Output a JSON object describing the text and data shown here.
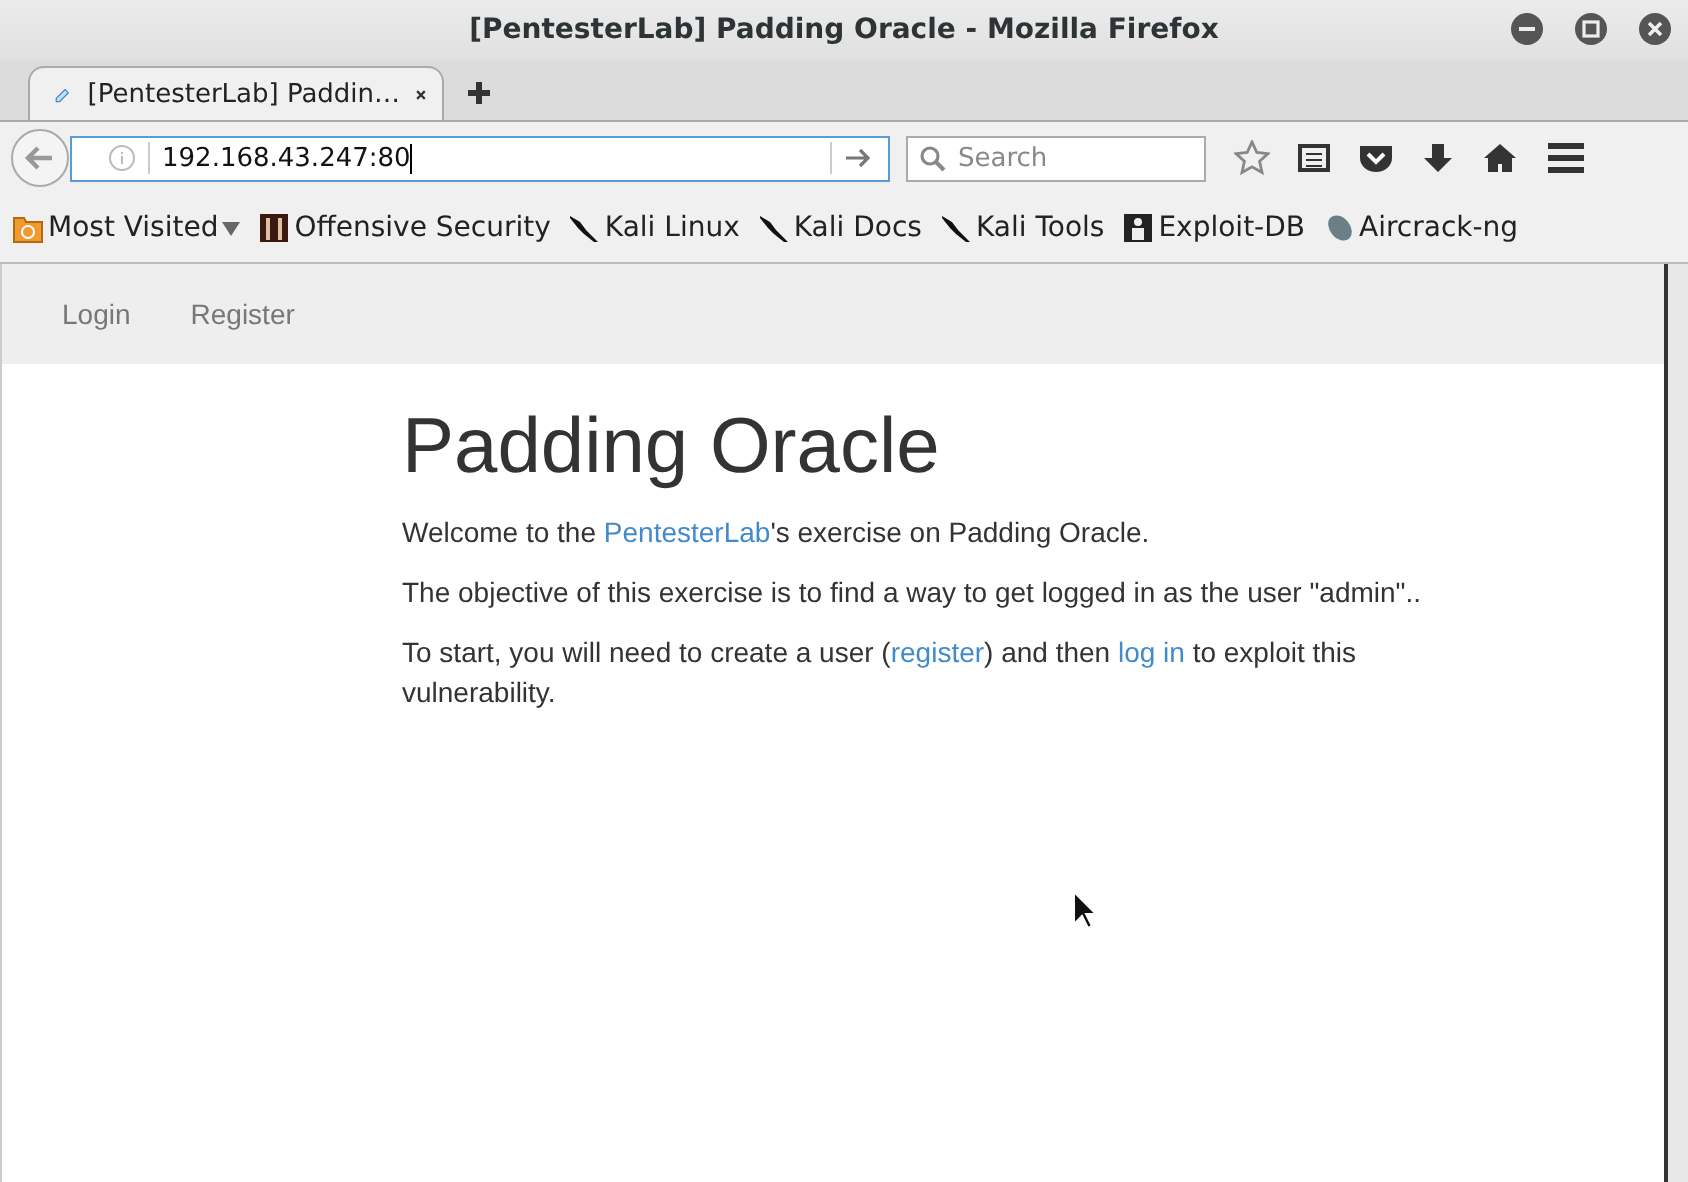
{
  "window": {
    "title": "[PentesterLab] Padding Oracle - Mozilla Firefox"
  },
  "tabs": [
    {
      "label": "[PentesterLab] Paddin…",
      "selected": true
    }
  ],
  "address_bar": {
    "value": "192.168.43.247:80"
  },
  "search": {
    "placeholder": "Search"
  },
  "bookmarks": [
    {
      "label": "Most Visited",
      "kind": "folder"
    },
    {
      "label": "Offensive Security",
      "kind": "offsec"
    },
    {
      "label": "Kali Linux",
      "kind": "kali"
    },
    {
      "label": "Kali Docs",
      "kind": "kali"
    },
    {
      "label": "Kali Tools",
      "kind": "kali"
    },
    {
      "label": "Exploit-DB",
      "kind": "exploitdb"
    },
    {
      "label": "Aircrack-ng",
      "kind": "aircrack"
    }
  ],
  "site_nav": [
    "Login",
    "Register"
  ],
  "heading": "Padding Oracle",
  "paragraphs": [
    [
      {
        "text": "Welcome to the "
      },
      {
        "text": "PentesterLab",
        "link": true
      },
      {
        "text": "'s exercise on Padding Oracle."
      }
    ],
    [
      {
        "text": "The objective of this exercise is to find a way to get logged in as the user \"admin\".."
      }
    ],
    [
      {
        "text": "To start, you will need to create a user ("
      },
      {
        "text": "register",
        "link": true
      },
      {
        "text": ") and then "
      },
      {
        "text": "log in",
        "link": true
      },
      {
        "text": " to exploit this vulnerability."
      }
    ]
  ]
}
